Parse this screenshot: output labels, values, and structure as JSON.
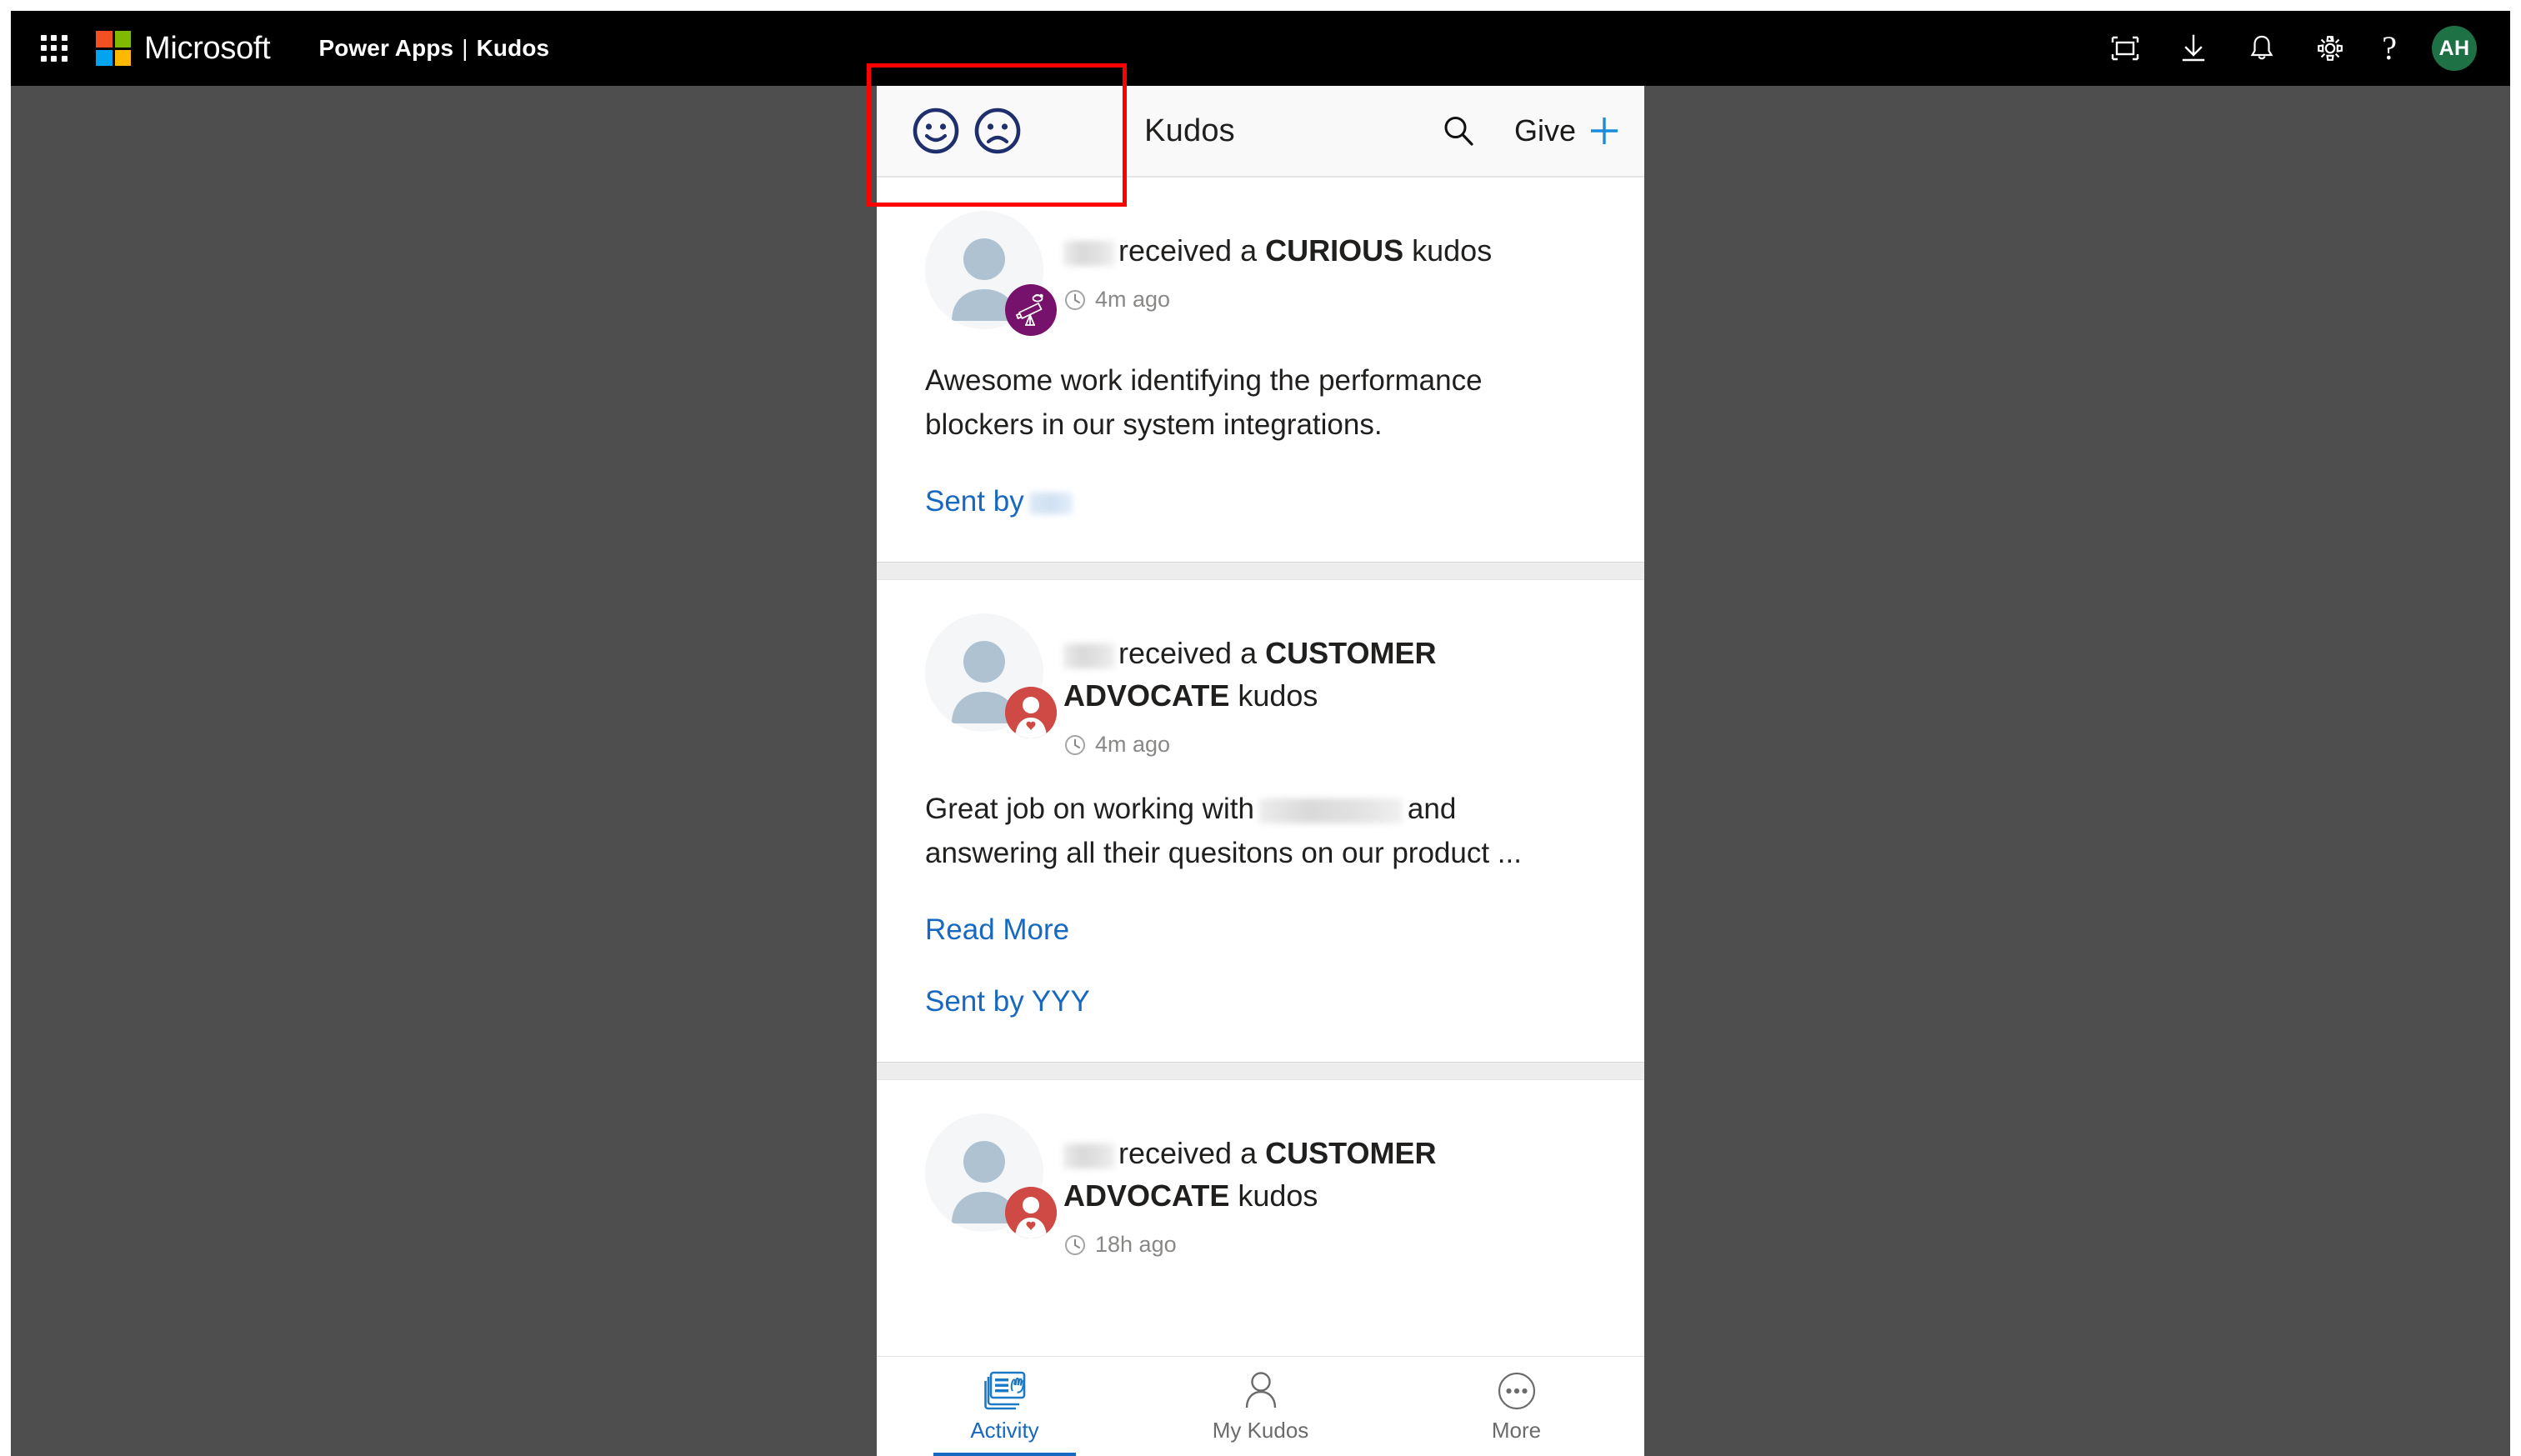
{
  "topbar": {
    "waffle_label": "app-launcher",
    "brand": "Microsoft",
    "product": "Power Apps",
    "separator": "|",
    "app": "Kudos",
    "icons": [
      {
        "name": "fullscreen-icon",
        "label": "Full screen"
      },
      {
        "name": "download-icon",
        "label": "Download"
      },
      {
        "name": "notification-bell-icon",
        "label": "Notifications"
      },
      {
        "name": "settings-gear-icon",
        "label": "Settings"
      }
    ],
    "help_glyph": "?",
    "account_initials": "AH",
    "account_color": "#1e7145"
  },
  "app_header": {
    "feedback": {
      "happy_label": "Happy feedback",
      "sad_label": "Sad feedback",
      "icon_color": "#1f2f6e"
    },
    "title": "Kudos",
    "search_label": "Search",
    "give_label": "Give",
    "plus_color": "#1b8bdc"
  },
  "feed": [
    {
      "recipient_redacted": true,
      "headline_prefix": "received a ",
      "kudos_type": "CURIOUS",
      "headline_suffix": " kudos",
      "time": "4m ago",
      "badge": {
        "name": "telescope-icon",
        "color": "#76126b"
      },
      "message": "Awesome work identifying the performance blockers in our system integrations.",
      "read_more": null,
      "sent_by_label": "Sent by",
      "sent_by_name": "",
      "sender_redacted": true
    },
    {
      "recipient_redacted": true,
      "headline_prefix": "received a ",
      "kudos_type": "CUSTOMER ADVOCATE",
      "headline_suffix": " kudos",
      "time": "4m ago",
      "badge": {
        "name": "customer-advocate-icon",
        "color": "#cf4a44"
      },
      "message_part1": "Great job on working with",
      "message_part2": "and answering all their quesitons on our product ...",
      "read_more": "Read More",
      "sent_by_label": "Sent by YYY",
      "sender_redacted": false
    },
    {
      "recipient_redacted": true,
      "headline_prefix": "received a ",
      "kudos_type": "CUSTOMER ADVOCATE",
      "headline_suffix": " kudos",
      "time": "18h ago",
      "badge": {
        "name": "customer-advocate-icon",
        "color": "#cf4a44"
      }
    }
  ],
  "bottom_nav": {
    "items": [
      {
        "label": "Activity",
        "icon": "activity-cards-clap-icon",
        "active": true
      },
      {
        "label": "My Kudos",
        "icon": "person-outline-icon",
        "active": false
      },
      {
        "label": "More",
        "icon": "ellipsis-circle-icon",
        "active": false
      }
    ],
    "active_color": "#1668c1"
  },
  "annotation": {
    "highlight_name": "feedback-faces-highlight",
    "color": "#ff0000"
  }
}
